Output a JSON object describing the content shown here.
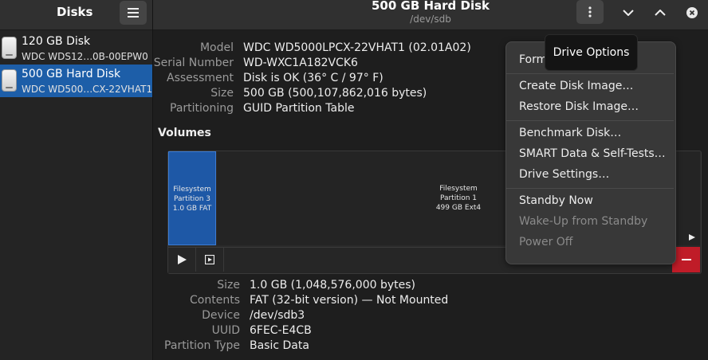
{
  "sidebar": {
    "title": "Disks",
    "disks": [
      {
        "name": "120 GB Disk",
        "model": "WDC WDS12…",
        "serial": "0B-00EPW0"
      },
      {
        "name": "500 GB Hard Disk",
        "model": "WDC WD500…",
        "serial": "CX-22VHAT1"
      }
    ]
  },
  "header": {
    "title": "500 GB Hard Disk",
    "subtitle": "/dev/sdb"
  },
  "drive_info": [
    {
      "label": "Model",
      "value": "WDC WD5000LPCX-22VHAT1 (02.01A02)"
    },
    {
      "label": "Serial Number",
      "value": "WD-WXC1A182VCK6"
    },
    {
      "label": "Assessment",
      "value": "Disk is OK (36° C / 97° F)"
    },
    {
      "label": "Size",
      "value": "500 GB (500,107,862,016 bytes)"
    },
    {
      "label": "Partitioning",
      "value": "GUID Partition Table"
    }
  ],
  "volumes": {
    "heading": "Volumes",
    "partitions": [
      {
        "line1": "Filesystem",
        "line2": "Partition 3",
        "line3": "1.0 GB FAT"
      },
      {
        "line1": "Filesystem",
        "line2": "Partition 1",
        "line3": "499 GB Ext4"
      }
    ]
  },
  "partition_info": [
    {
      "label": "Size",
      "value": "1.0 GB (1,048,576,000 bytes)"
    },
    {
      "label": "Contents",
      "value": "FAT (32-bit version) — Not Mounted"
    },
    {
      "label": "Device",
      "value": "/dev/sdb3"
    },
    {
      "label": "UUID",
      "value": "6FEC-E4CB"
    },
    {
      "label": "Partition Type",
      "value": "Basic Data"
    }
  ],
  "tooltip": "Drive Options",
  "menu": {
    "items": [
      {
        "label": "Format Disk…"
      },
      {
        "label": "Create Disk Image…"
      },
      {
        "label": "Restore Disk Image…"
      },
      {
        "label": "Benchmark Disk…"
      },
      {
        "label": "SMART Data & Self-Tests…"
      },
      {
        "label": "Drive Settings…"
      },
      {
        "label": "Standby Now"
      },
      {
        "label": "Wake-Up from Standby",
        "disabled": true
      },
      {
        "label": "Power Off",
        "disabled": true
      }
    ]
  },
  "colors": {
    "accent": "#1d5ea8",
    "partition_selected": "#1e58a6",
    "danger": "#c01c28"
  }
}
